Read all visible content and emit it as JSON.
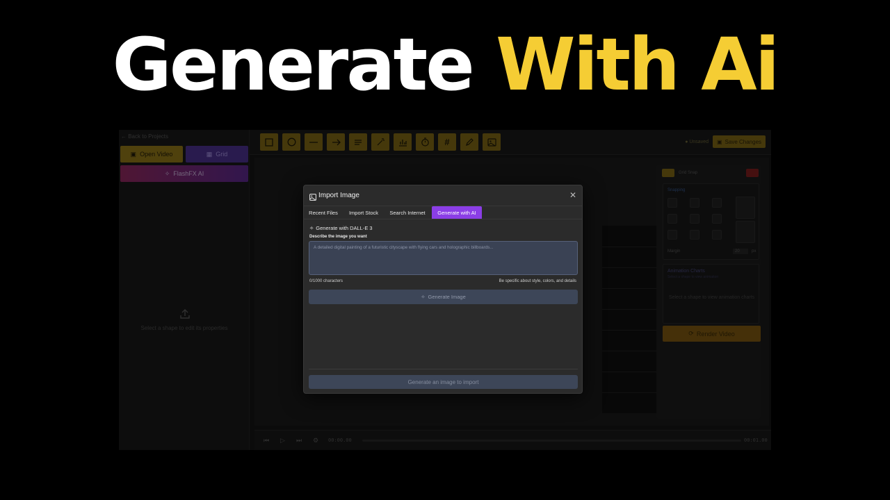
{
  "headline": {
    "part1": "Generate",
    "part2": "With Ai"
  },
  "colors": {
    "accent_yellow": "#f5cd34",
    "accent_purple": "#8b3ee6",
    "background": "#000000"
  },
  "sidebar": {
    "back_label": "← Back to Projects",
    "open_video": "Open Video",
    "grid": "Grid",
    "flashfx_ai": "FlashFX AI",
    "empty_state": "Select a shape to edit its properties"
  },
  "toolbar": {
    "tools": [
      "rectangle-icon",
      "circle-icon",
      "line-icon",
      "arrow-icon",
      "text-icon",
      "magic-wand-icon",
      "chart-icon",
      "timer-icon",
      "hash-icon",
      "pencil-icon",
      "image-icon"
    ],
    "unsaved": "● Unsaved",
    "save_label": "Save Changes"
  },
  "right_panel": {
    "grid_snap": "Grid Snap",
    "snapping": "Snapping",
    "margin_label": "Margin",
    "margin_value": "20",
    "margin_unit": "px",
    "animation_charts": "Animation Charts",
    "animation_sub": "Select a shape to view animation",
    "animation_empty": "Select a shape to view animation charts",
    "render": "Render Video"
  },
  "timeline": {
    "current": "00:00.00",
    "total": "00:01.00"
  },
  "modal": {
    "title": "Import Image",
    "tabs": [
      "Recent Files",
      "Import Stock",
      "Search Internet",
      "Generate with AI"
    ],
    "active_tab": 3,
    "gen_header": "Generate with DALL-E 3",
    "describe_label": "Describe the image you want",
    "prompt_placeholder": "A detailed digital painting of a futuristic cityscape with flying cars and holographic billboards...",
    "char_count": "0/1000 characters",
    "hint": "Be specific about style, colors, and details",
    "generate_button": "Generate Image",
    "import_button": "Generate an image to import"
  }
}
